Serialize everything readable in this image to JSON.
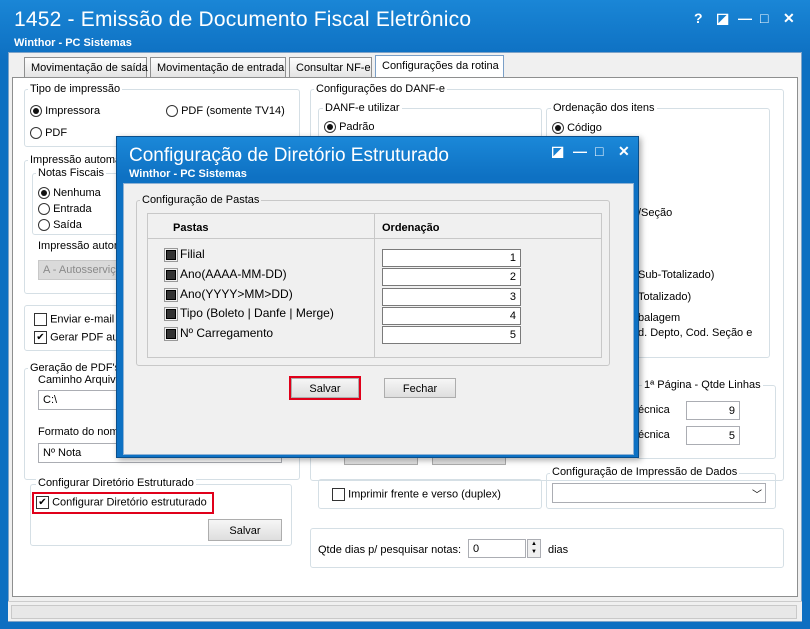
{
  "window": {
    "title": "1452 - Emissão de Documento Fiscal Eletrônico",
    "subtitle": "Winthor - PC Sistemas",
    "buttons": [
      "?",
      "◪",
      "—",
      "□",
      "✕"
    ]
  },
  "tabs": [
    "Movimentação de saída",
    "Movimentação de entrada",
    "Consultar NF-e",
    "Configurações da rotina"
  ],
  "left": {
    "tipo_impressao": {
      "label": "Tipo de impressão",
      "options": [
        "Impressora",
        "PDF (somente TV14)",
        "PDF"
      ],
      "selected": "Impressora"
    },
    "impressao_auto": {
      "label": "Impressão automá",
      "notas_label": "Notas Fiscais",
      "notas_options": [
        "Nenhuma",
        "Entrada",
        "Saída"
      ],
      "notas_selected": "Nenhuma",
      "impressao_label": "Impressão autom",
      "impressao_value": "A - Autosserviço"
    },
    "enviar_email": "Enviar e-mail a",
    "gerar_pdf": "Gerar PDF aut",
    "geracao_pdfs": {
      "label": "Geração de PDF's",
      "caminho_label": "Caminho Arquivo",
      "caminho_value": "C:\\",
      "formato_label": "Formato do nome",
      "formato_value": "Nº Nota"
    },
    "diretorio": {
      "label": "Configurar Diretório Estruturado",
      "checkbox": "Configurar Diretório estruturado",
      "save": "Salvar"
    }
  },
  "right": {
    "danfe_config_label": "Configurações do DANF-e",
    "danfe_utilizar_label": "DANF-e utilizar",
    "danfe_utilizar_value": "Padrão",
    "ordenacao_label": "Ordenação dos itens",
    "ordenacao_value": "Código",
    "partial_seccao": "/Seção",
    "partial_subtot": "Sub-Totalizado)",
    "partial_tot": "Totalizado)",
    "partial_emb": "balagem",
    "partial_depto": "d. Depto, Cod. Seção e",
    "pagina_label": "1ª Página - Qtde Linhas",
    "linhas": [
      {
        "label": "écnica",
        "value": "9"
      },
      {
        "label": "écnica",
        "value": "5"
      }
    ],
    "duplex": "Imprimir frente e verso (duplex)",
    "config_impressao_label": "Configuração de Impressão de Dados",
    "qtde_dias_label": "Qtde dias p/ pesquisar notas:",
    "qtde_dias_value": "0",
    "qtde_dias_unit": "dias"
  },
  "modal": {
    "title": "Configuração de Diretório Estruturado",
    "subtitle": "Winthor - PC Sistemas",
    "buttons": [
      "◪",
      "—",
      "□",
      "✕"
    ],
    "group_label": "Configuração de Pastas",
    "col_pastas": "Pastas",
    "col_ordenacao": "Ordenação",
    "rows": [
      {
        "pasta": "Filial",
        "ordem": "1"
      },
      {
        "pasta": "Ano(AAAA-MM-DD)",
        "ordem": "2"
      },
      {
        "pasta": "Ano(YYYY>MM>DD)",
        "ordem": "3"
      },
      {
        "pasta": "Tipo (Boleto | Danfe | Merge)",
        "ordem": "4"
      },
      {
        "pasta": "Nº Carregamento",
        "ordem": "5"
      }
    ],
    "save": "Salvar",
    "close": "Fechar"
  }
}
